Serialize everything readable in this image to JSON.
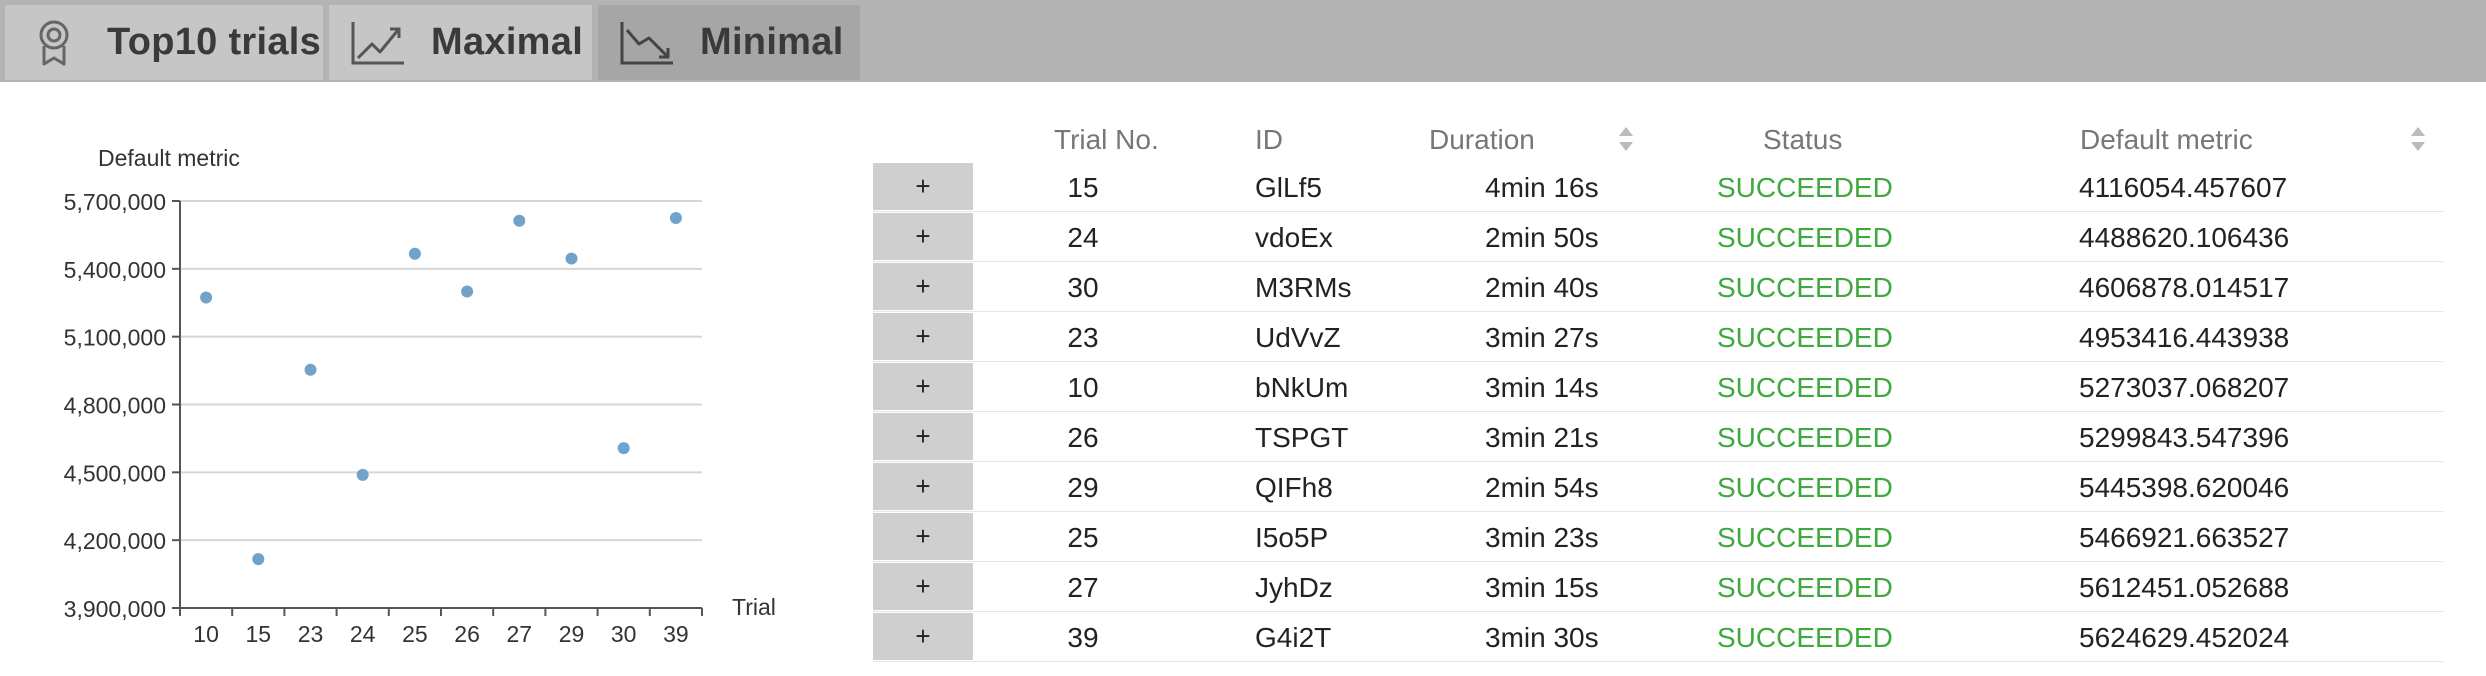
{
  "tabs": [
    {
      "label": "Top10 trials",
      "icon": "award-ribbon-icon"
    },
    {
      "label": "Maximal",
      "icon": "trend-up-icon"
    },
    {
      "label": "Minimal",
      "icon": "trend-down-icon"
    }
  ],
  "table": {
    "columns": [
      "Trial No.",
      "ID",
      "Duration",
      "Status",
      "Default metric"
    ],
    "expand_label": "+",
    "rows": [
      {
        "trial": "15",
        "id": "GlLf5",
        "duration": "4min 16s",
        "status": "SUCCEEDED",
        "metric": "4116054.457607"
      },
      {
        "trial": "24",
        "id": "vdoEx",
        "duration": "2min 50s",
        "status": "SUCCEEDED",
        "metric": "4488620.106436"
      },
      {
        "trial": "30",
        "id": "M3RMs",
        "duration": "2min 40s",
        "status": "SUCCEEDED",
        "metric": "4606878.014517"
      },
      {
        "trial": "23",
        "id": "UdVvZ",
        "duration": "3min 27s",
        "status": "SUCCEEDED",
        "metric": "4953416.443938"
      },
      {
        "trial": "10",
        "id": "bNkUm",
        "duration": "3min 14s",
        "status": "SUCCEEDED",
        "metric": "5273037.068207"
      },
      {
        "trial": "26",
        "id": "TSPGT",
        "duration": "3min 21s",
        "status": "SUCCEEDED",
        "metric": "5299843.547396"
      },
      {
        "trial": "29",
        "id": "QIFh8",
        "duration": "2min 54s",
        "status": "SUCCEEDED",
        "metric": "5445398.620046"
      },
      {
        "trial": "25",
        "id": "I5o5P",
        "duration": "3min 23s",
        "status": "SUCCEEDED",
        "metric": "5466921.663527"
      },
      {
        "trial": "27",
        "id": "JyhDz",
        "duration": "3min 15s",
        "status": "SUCCEEDED",
        "metric": "5612451.052688"
      },
      {
        "trial": "39",
        "id": "G4i2T",
        "duration": "3min 30s",
        "status": "SUCCEEDED",
        "metric": "5624629.452024"
      }
    ]
  },
  "chart_data": {
    "type": "scatter",
    "ylabel": "Default metric",
    "xlabel": "Trial",
    "categories": [
      "10",
      "15",
      "23",
      "24",
      "25",
      "26",
      "27",
      "29",
      "30",
      "39"
    ],
    "values": [
      5273037.068207,
      4116054.457607,
      4953416.443938,
      4488620.106436,
      5466921.663527,
      5299843.547396,
      5612451.052688,
      5445398.620046,
      4606878.014517,
      5624629.452024
    ],
    "ylim": [
      3900000,
      5700000
    ],
    "yticks": [
      3900000,
      4200000,
      4500000,
      4800000,
      5100000,
      5400000,
      5700000
    ],
    "ytick_labels": [
      "3,900,000",
      "4,200,000",
      "4,500,000",
      "4,800,000",
      "5,100,000",
      "5,400,000",
      "5,700,000"
    ],
    "grid": true,
    "point_color": "#6fa3cc"
  },
  "colors": {
    "status_success": "#3fa93f",
    "tabbar": "#b3b3b3",
    "expand_button": "#cfcfcf"
  }
}
